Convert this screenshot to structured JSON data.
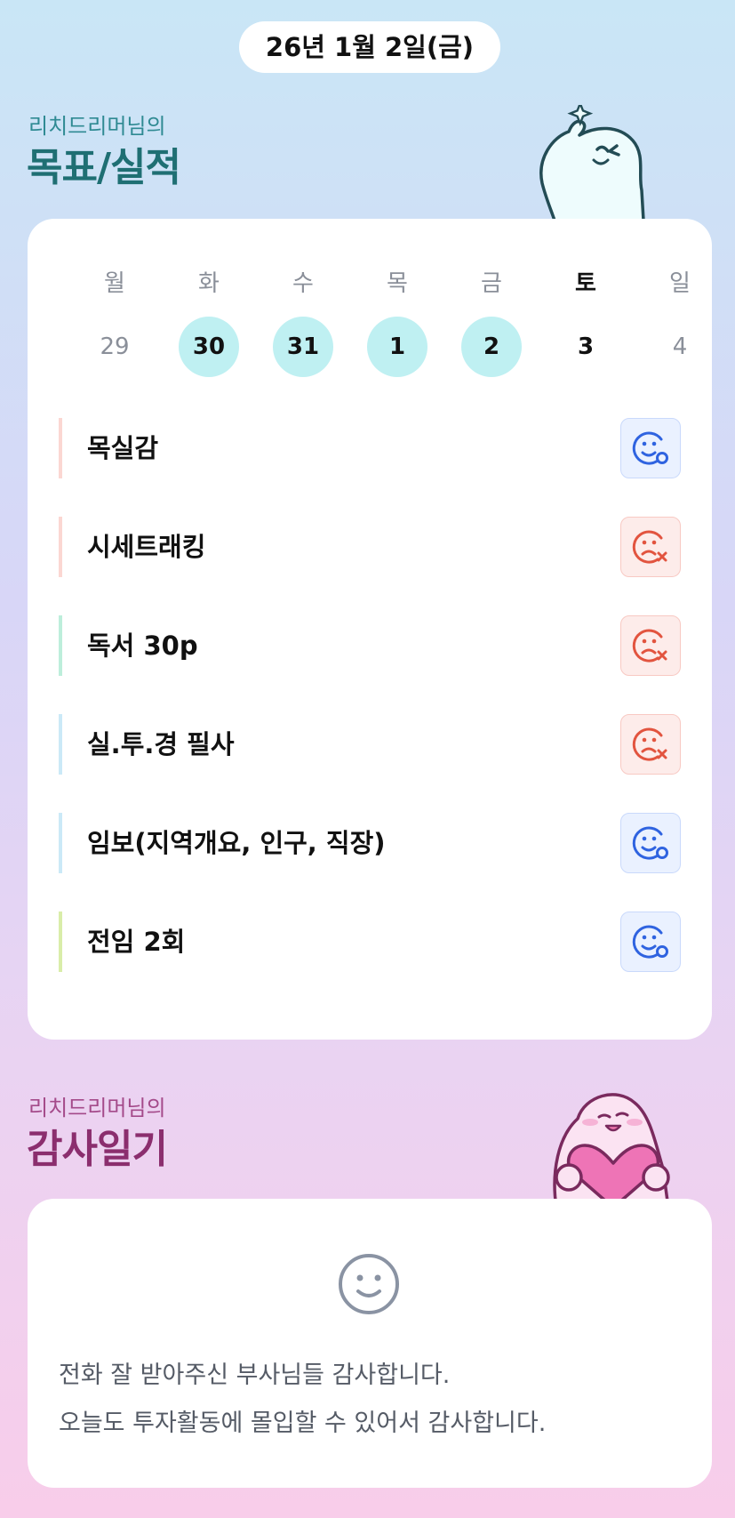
{
  "header": {
    "date": "26년 1월 2일(금)"
  },
  "goals_section": {
    "subtitle": "리치드리머님의",
    "title": "목표/실적",
    "weekdays": [
      "월",
      "화",
      "수",
      "목",
      "금",
      "토",
      "일"
    ],
    "dates": [
      {
        "label": "29",
        "state": "muted"
      },
      {
        "label": "30",
        "state": "done"
      },
      {
        "label": "31",
        "state": "done"
      },
      {
        "label": "1",
        "state": "done"
      },
      {
        "label": "2",
        "state": "done"
      },
      {
        "label": "3",
        "state": "today"
      },
      {
        "label": "4",
        "state": "muted"
      }
    ],
    "goals": [
      {
        "label": "목실감",
        "status": "good",
        "bar_color": "#fbd7d2"
      },
      {
        "label": "시세트래킹",
        "status": "bad",
        "bar_color": "#fbd7d2"
      },
      {
        "label": "독서 30p",
        "status": "bad",
        "bar_color": "#bdeedb"
      },
      {
        "label": "실.투.경 필사",
        "status": "bad",
        "bar_color": "#cbe9f7"
      },
      {
        "label": "임보(지역개요, 인구, 직장)",
        "status": "good",
        "bar_color": "#cbe9f7"
      },
      {
        "label": "전임 2회",
        "status": "good",
        "bar_color": "#d9eda9"
      }
    ],
    "status_icons": {
      "good": "smile-check-icon",
      "bad": "frown-x-icon"
    },
    "colors": {
      "good": "#2f63e0",
      "bad": "#e2543f",
      "done_date": "#bff0f2"
    }
  },
  "gratitude_section": {
    "subtitle": "리치드리머님의",
    "title": "감사일기",
    "icon": "smile-icon",
    "lines": [
      "전화 잘 받아주신 부사님들 감사합니다.",
      "오늘도 투자활동에 몰입할 수 있어서 감사합니다."
    ]
  }
}
